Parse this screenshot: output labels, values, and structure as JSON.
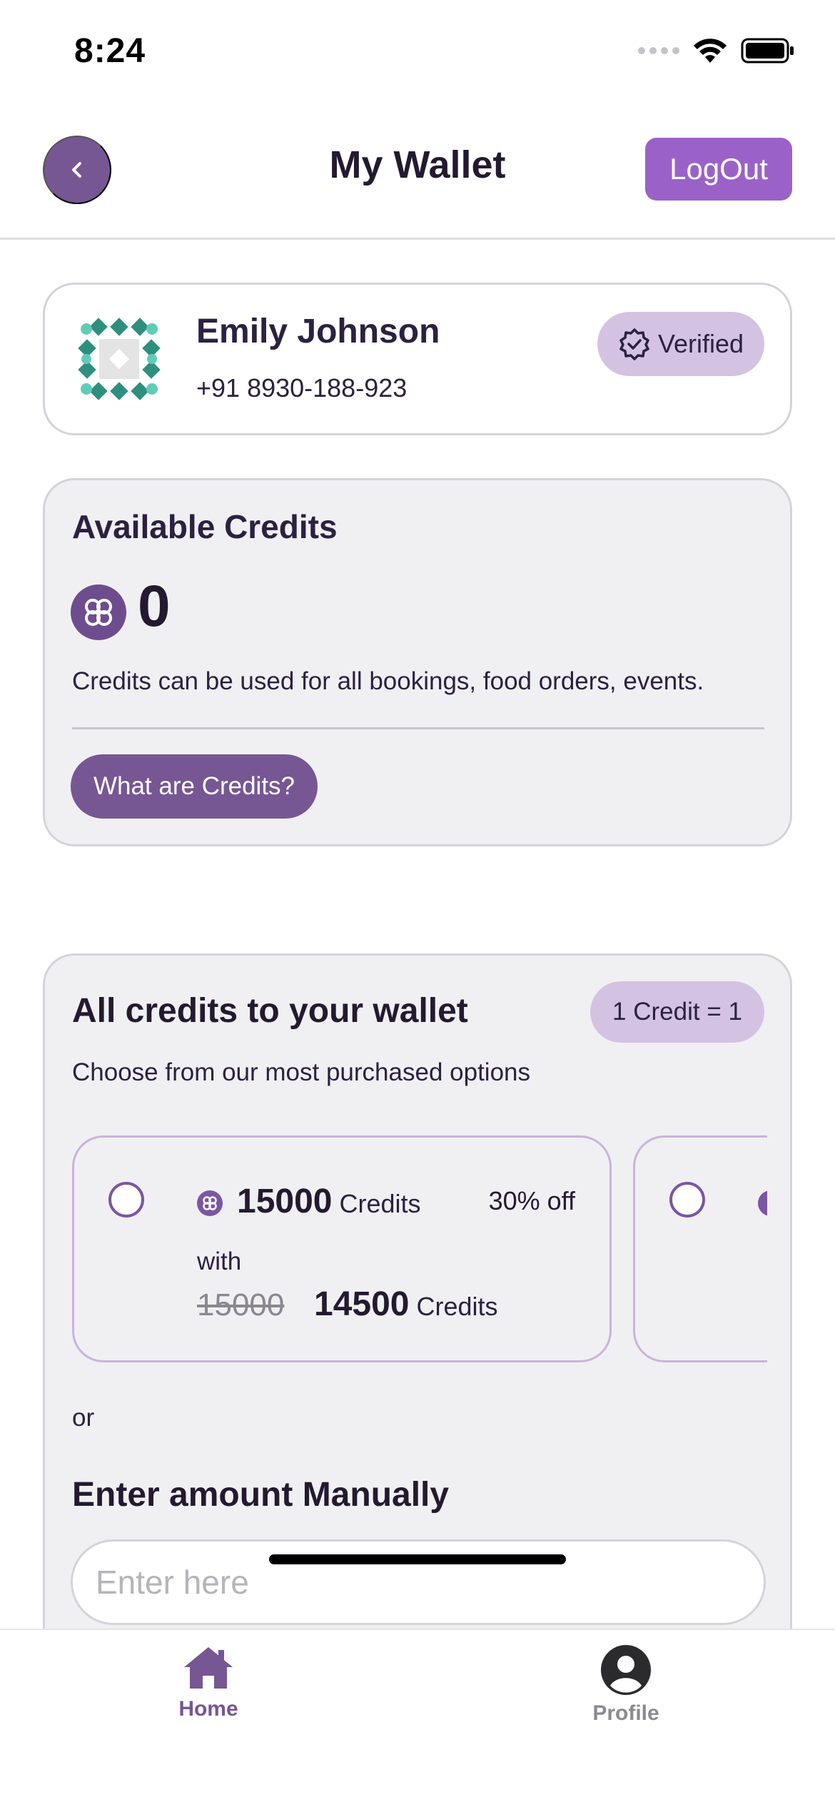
{
  "status_bar": {
    "time": "8:24"
  },
  "header": {
    "title": "My Wallet",
    "logout_label": "LogOut",
    "back_icon": "chevron-left-icon"
  },
  "profile": {
    "name": "Emily Johnson",
    "phone": "+91 8930-188-923",
    "verified_label": "Verified"
  },
  "credits": {
    "title": "Available Credits",
    "value": "0",
    "description": "Credits can be used for all bookings, food orders, events.",
    "info_button_label": "What are Credits?"
  },
  "purchase": {
    "title": "All credits to your wallet",
    "rate_label": "1 Credit = 1",
    "subtitle": "Choose from our most purchased options",
    "options": [
      {
        "amount": "15000",
        "amount_unit": "Credits",
        "discount": "30% off",
        "with_label": "with",
        "old_price": "15000",
        "new_price": "14500",
        "new_unit": "Credits",
        "selected": false
      },
      {
        "selected": false
      }
    ],
    "or_label": "or",
    "manual_title": "Enter amount Manually",
    "manual_placeholder": "Enter here"
  },
  "nav": {
    "home_label": "Home",
    "profile_label": "Profile",
    "active": "Home"
  },
  "colors": {
    "primary": "#775694",
    "logout": "#9a62c9",
    "badge": "#d4c2e3",
    "card_bg": "#f0f0f3"
  }
}
